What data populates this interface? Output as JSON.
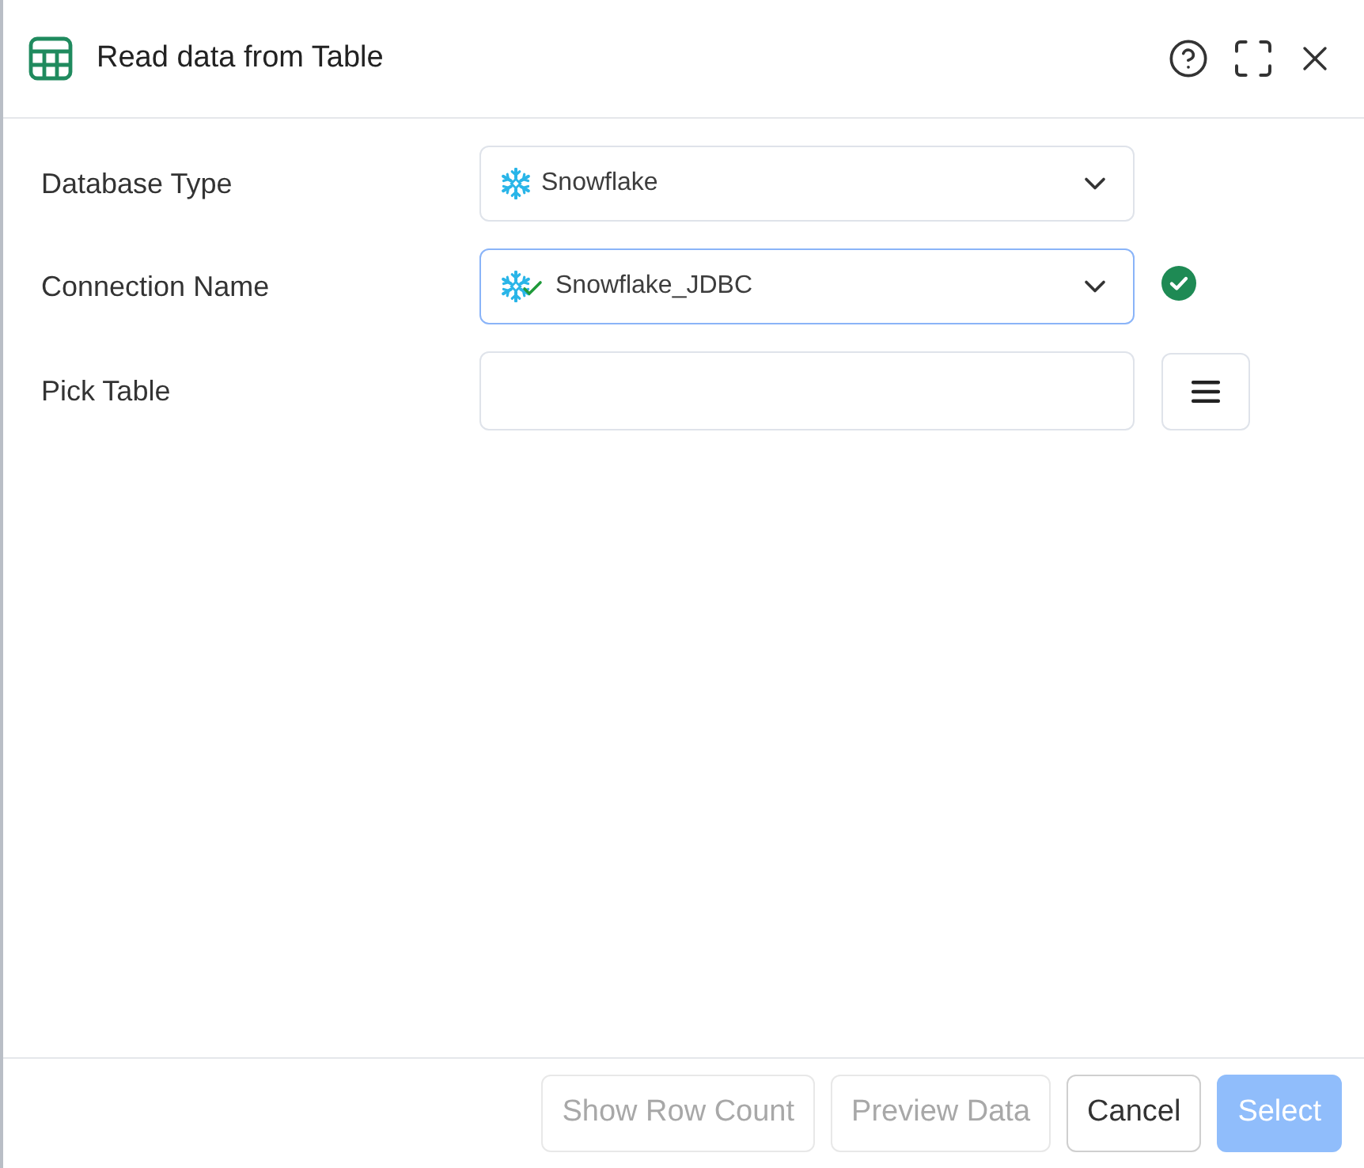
{
  "dialog": {
    "title": "Read data from Table"
  },
  "fields": [
    {
      "label": "Database Type",
      "kind": "select",
      "value": "Snowflake",
      "focused": false,
      "verified": false
    },
    {
      "label": "Connection Name",
      "kind": "select",
      "value": "Snowflake_JDBC",
      "focused": true,
      "verified": true
    },
    {
      "label": "Pick Table",
      "kind": "table-picker",
      "focused": false
    }
  ],
  "footer_buttons": [
    {
      "label": "Show Row Count",
      "kind": "secondary",
      "disabled": true
    },
    {
      "label": "Preview Data",
      "kind": "secondary",
      "disabled": true
    },
    {
      "label": "Cancel",
      "kind": "secondary",
      "disabled": false
    },
    {
      "label": "Select",
      "kind": "primary",
      "disabled": true
    }
  ]
}
